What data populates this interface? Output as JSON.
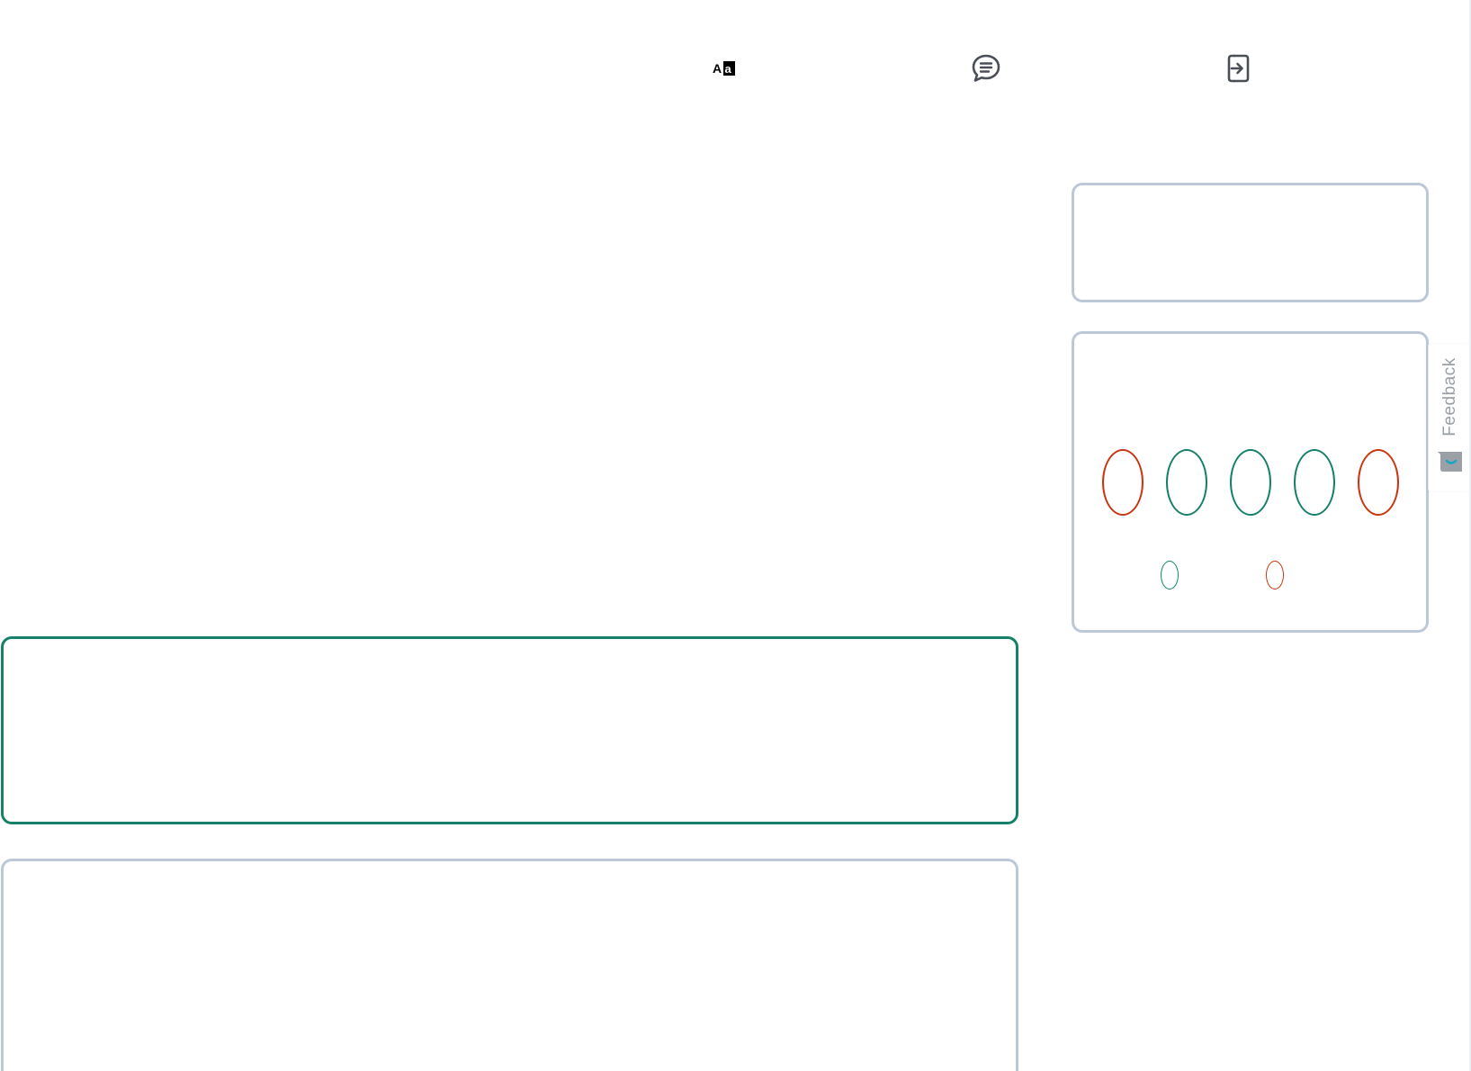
{
  "toolbar": {
    "icons": [
      {
        "name": "translate-icon",
        "glyph": "Aa"
      },
      {
        "name": "chat-icon"
      },
      {
        "name": "login-icon"
      }
    ]
  },
  "feedback": {
    "label": "Feedback"
  },
  "indicators": {
    "large": [
      {
        "status": "incorrect",
        "color": "#c9350f"
      },
      {
        "status": "correct",
        "color": "#168068"
      },
      {
        "status": "correct",
        "color": "#168068"
      },
      {
        "status": "correct",
        "color": "#168068"
      },
      {
        "status": "incorrect",
        "color": "#c9350f"
      }
    ],
    "small": [
      {
        "status": "correct",
        "color": "#168068"
      },
      {
        "status": "incorrect",
        "color": "#c9350f"
      }
    ]
  },
  "colors": {
    "correct": "#168068",
    "incorrect": "#c9350f",
    "card_border": "#bcc8d8",
    "icon_gray": "#4a4f57"
  }
}
